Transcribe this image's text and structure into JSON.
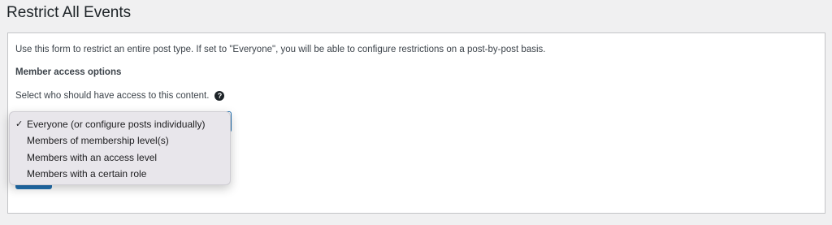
{
  "page": {
    "title": "Restrict All Events"
  },
  "panel": {
    "intro": "Use this form to restrict an entire post type. If set to \"Everyone\", you will be able to configure restrictions on a post-by-post basis.",
    "section_heading": "Member access options",
    "question": "Select who should have access to this content.",
    "help_icon": "?"
  },
  "access_select": {
    "selected": "Everyone (or configure posts individually)",
    "checkmark": "✓",
    "options": [
      "Everyone (or configure posts individually)",
      "Members of membership level(s)",
      "Members with an access level",
      "Members with a certain role"
    ]
  },
  "colors": {
    "accent": "#2271b1",
    "background": "#f0f0f1",
    "panel": "#ffffff",
    "dropdown": "#e8e6eb"
  },
  "icons": {
    "help": "question-circle-icon",
    "check": "checkmark-icon"
  }
}
